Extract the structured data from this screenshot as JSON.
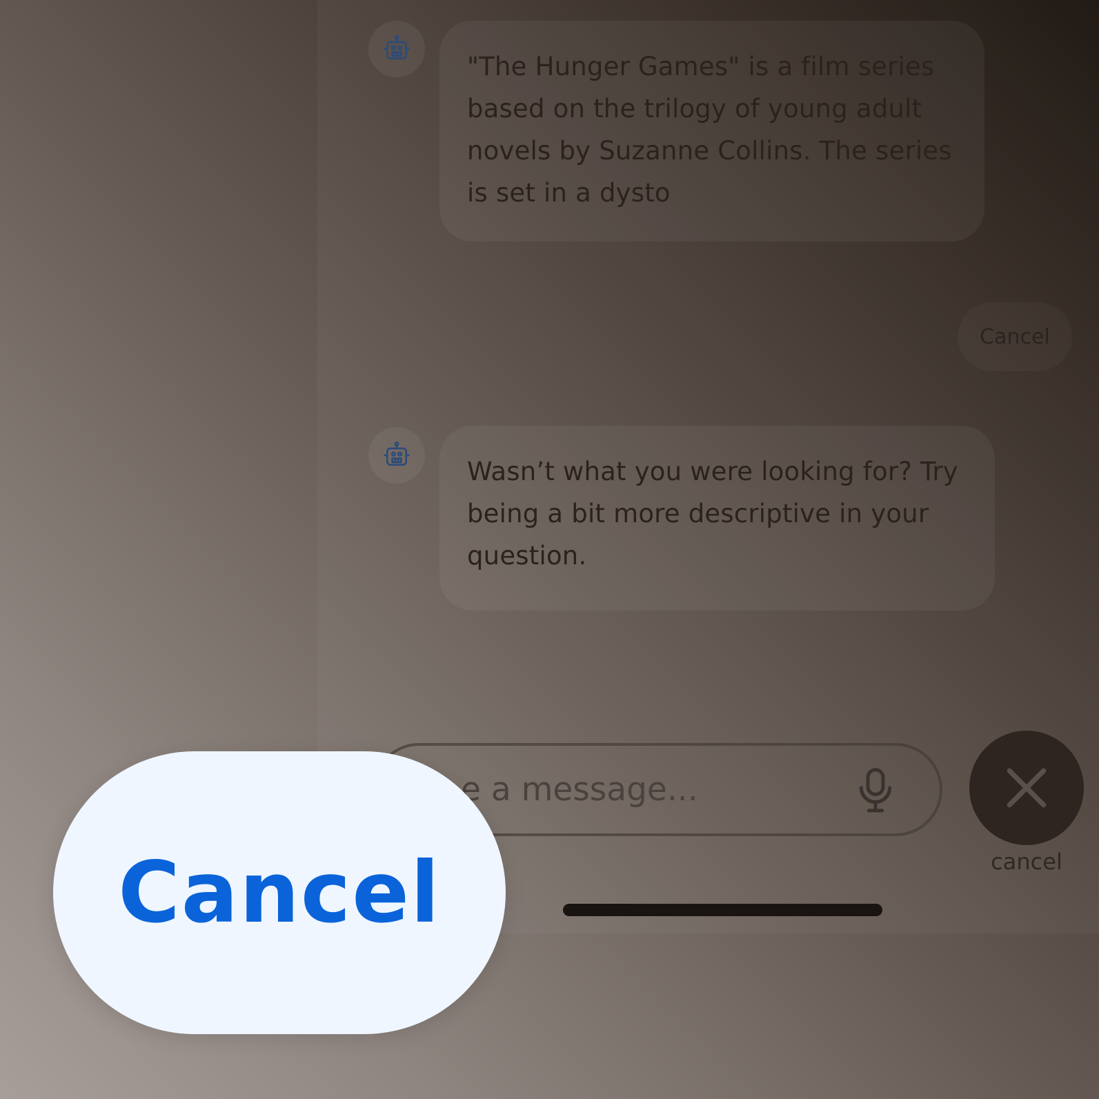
{
  "chat": {
    "messages": [
      {
        "sender": "bot",
        "text": "\"The Hunger Games\" is a film series based on the trilogy of young adult novels by Suzanne Collins. The series is set in a dysto"
      },
      {
        "sender": "bot",
        "text": "Wasn’t what you were looking for? Try being a bit more descriptive in your question."
      }
    ],
    "cancel_chip_label": "Cancel"
  },
  "composer": {
    "placeholder_visible": "e a message...",
    "close_label": "cancel"
  },
  "overlay": {
    "cancel_label": "Cancel"
  },
  "colors": {
    "accent": "#0a63d9",
    "overlay_bg": "#eff6ff",
    "robot_icon": "#2b4b7a"
  },
  "icons": [
    "robot-icon",
    "microphone-icon",
    "close-icon"
  ]
}
